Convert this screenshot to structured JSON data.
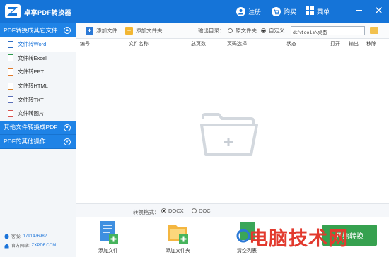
{
  "app": {
    "title": "卓享PDF转换器",
    "actions": [
      {
        "label": "注册",
        "icon": "user-icon"
      },
      {
        "label": "购买",
        "icon": "cart-icon"
      },
      {
        "label": "菜单",
        "icon": "grid-menu-icon"
      }
    ]
  },
  "sidebar": {
    "categories": [
      {
        "label": "PDF转换成其它文件",
        "expanded": true
      },
      {
        "label": "其他文件转换成PDF",
        "expanded": false
      },
      {
        "label": "PDF的其他操作",
        "expanded": false
      }
    ],
    "items": [
      {
        "label": "文件转Word",
        "active": true,
        "icon": "word-file-icon"
      },
      {
        "label": "文件转Excel",
        "active": false,
        "icon": "excel-file-icon"
      },
      {
        "label": "文件转PPT",
        "active": false,
        "icon": "ppt-file-icon"
      },
      {
        "label": "文件转HTML",
        "active": false,
        "icon": "html-file-icon"
      },
      {
        "label": "文件转TXT",
        "active": false,
        "icon": "txt-file-icon"
      },
      {
        "label": "文件转图片",
        "active": false,
        "icon": "image-file-icon"
      }
    ],
    "contact": {
      "qq_label": "客服:",
      "qq_value": "1791476982",
      "site_label": "官方网站:",
      "site_value": "ZXPDF.COM"
    }
  },
  "toolbar": {
    "add_file": "添加文件",
    "add_folder": "添加文件夹",
    "output_label": "输出目录：",
    "opt_source": "原文件夹",
    "opt_custom": "自定义",
    "selected": "custom",
    "path": "d:\\tools\\桌面"
  },
  "table": {
    "columns": [
      "编号",
      "文件名称",
      "总页数",
      "页码选择",
      "状态",
      "打开",
      "输出",
      "移除"
    ],
    "rows": []
  },
  "format": {
    "label": "转换格式：",
    "options": [
      "DOCX",
      "DOC"
    ],
    "selected": "DOCX"
  },
  "bottom": {
    "add_file": "添加文件",
    "add_folder": "添加文件夹",
    "clear_list": "清空列表",
    "start": "开始转换"
  },
  "watermark": "电脑技术网",
  "colors": {
    "brand_blue": "#1574d8",
    "category_blue": "#1f83e6",
    "active_text": "#1a73d9",
    "start_green": "#2c9d46",
    "watermark_red": "#e23a2e"
  }
}
